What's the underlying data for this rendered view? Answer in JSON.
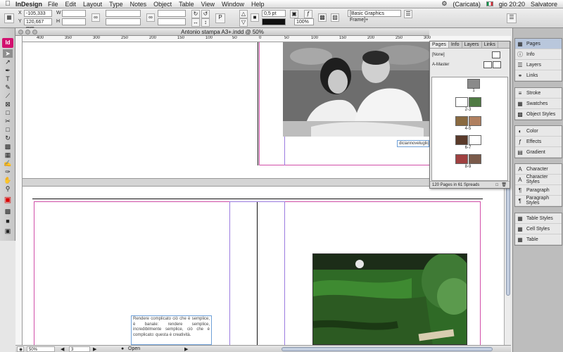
{
  "menubar": {
    "app": "InDesign",
    "menus": [
      "File",
      "Edit",
      "Layout",
      "Type",
      "Notes",
      "Object",
      "Table",
      "View",
      "Window",
      "Help"
    ],
    "status_right": "(Caricata)",
    "clock": "gio 20:20",
    "user": "Salvatore"
  },
  "control": {
    "x_label": "X",
    "x_value": "-105,333 mm",
    "y_label": "Y",
    "y_value": "120,667 mm",
    "w_label": "W",
    "h_label": "H",
    "stroke_value": "0,5 pt",
    "opacity_value": "100%",
    "style_value": "[Basic Graphics Frame]+"
  },
  "tools": {
    "logo": "Id",
    "items": [
      "select-tool",
      "direct-select-tool",
      "pen-tool",
      "type-tool",
      "pencil-tool",
      "line-tool",
      "rectangle-frame-tool",
      "rectangle-tool",
      "scissors-tool",
      "free-transform-tool",
      "rotate-tool",
      "gradient-tool",
      "note-tool",
      "eyedropper-tool",
      "hand-tool",
      "zoom-tool",
      "fill-stroke-swatch",
      "default-colors",
      "apply-color",
      "normal-view-mode"
    ]
  },
  "document": {
    "title": "Antonio stampa A3+.indd @ 50%",
    "ruler_labels": [
      "400",
      "350",
      "300",
      "250",
      "200",
      "150",
      "100",
      "50",
      "0",
      "50",
      "100",
      "150",
      "200",
      "250",
      "300"
    ],
    "caption_text": "diciannoveluglio",
    "body_text": "Rendere complicato ciò che è semplice, è banale: rendere semplice, incredibilmente semplice, ciò che è complicato: questa è creatività."
  },
  "status": {
    "zoom": "50%",
    "page": "3",
    "preflight": "Open"
  },
  "pages_panel": {
    "tabs": [
      "Pages",
      "Info",
      "Layers",
      "Links"
    ],
    "none_label": "[None]",
    "master_label": "A-Master",
    "spread_labels": [
      "2-3",
      "4-5",
      "6-7",
      "8-9"
    ],
    "first_page_label": "1",
    "footer": "120 Pages in 61 Spreads"
  },
  "dock": {
    "group1": [
      "Pages",
      "Info",
      "Layers",
      "Links"
    ],
    "group2": [
      "Stroke",
      "Swatches",
      "Object Styles"
    ],
    "group3": [
      "Color",
      "Effects",
      "Gradient"
    ],
    "group4": [
      "Character",
      "Character Styles",
      "Paragraph",
      "Paragraph Styles"
    ],
    "group5": [
      "Table Styles",
      "Cell Styles",
      "Table"
    ]
  }
}
